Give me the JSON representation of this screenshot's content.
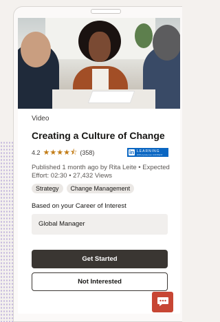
{
  "course": {
    "kind": "Video",
    "title": "Creating a Culture of Change",
    "rating": "4.2",
    "stars": "★★★★⯪",
    "review_count": "(358)",
    "provider_badge": {
      "mark": "in",
      "line1": "LEARNING",
      "line2": "WITH lynda.com CONTENT"
    },
    "meta": "Published 1 month ago by Rita Leite  •  Expected Effort: 02:30  •  27,432 Views",
    "tags": [
      "Strategy",
      "Change Management"
    ]
  },
  "recommendation": {
    "label": "Based on your Career of Interest",
    "career": "Global Manager"
  },
  "actions": {
    "primary": "Get Started",
    "secondary": "Not Interested"
  },
  "colors": {
    "accent": "#c74634",
    "primary_button": "#3a3632",
    "star": "#c27c16",
    "linkedin": "#0a66c2"
  },
  "icons": {
    "chat": "chat-icon"
  }
}
